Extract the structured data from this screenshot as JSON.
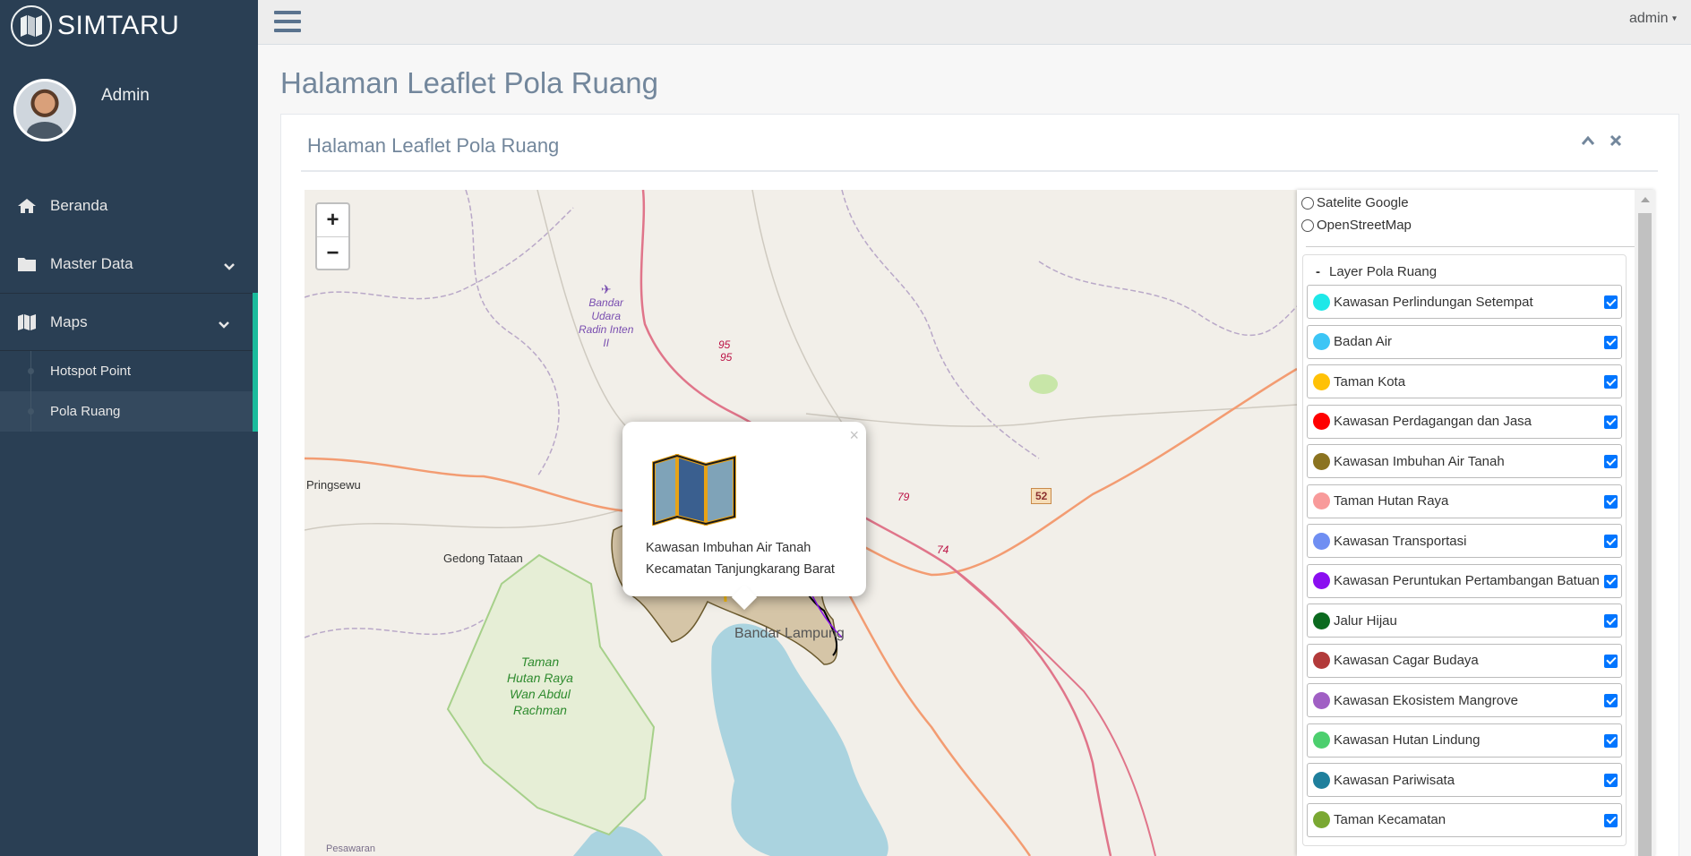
{
  "app": {
    "title": "SIMTARU",
    "icon": "map-icon"
  },
  "profile": {
    "name": "Admin"
  },
  "sidebar": {
    "items": [
      {
        "label": "Beranda",
        "icon": "home-icon"
      },
      {
        "label": "Master Data",
        "icon": "folder-icon"
      },
      {
        "label": "Maps",
        "icon": "map-icon"
      }
    ],
    "maps_submenu": [
      {
        "label": "Hotspot Point"
      },
      {
        "label": "Pola Ruang"
      }
    ]
  },
  "topnav": {
    "user": "admin"
  },
  "page": {
    "title": "Halaman Leaflet Pola Ruang"
  },
  "panel": {
    "title": "Halaman Leaflet Pola Ruang"
  },
  "map": {
    "zoom_in": "+",
    "zoom_out": "−",
    "labels": {
      "pringsewu": "Pringsewu",
      "gedong_tataan": "Gedong Tataan",
      "park_1": "Taman",
      "park_2": "Hutan Raya",
      "park_3": "Wan Abdul",
      "park_4": "Rachman",
      "airport_1": "Bandar",
      "airport_2": "Udara",
      "airport_3": "Radin Inten",
      "airport_4": "II",
      "bandar_lampung": "Bandar Lampung",
      "pesawaran": "Pesawaran",
      "road_95a": "95",
      "road_95b": "95",
      "road_79": "79",
      "road_74": "74",
      "shield_52": "52"
    },
    "popup": {
      "close": "×",
      "line1": "Kawasan Imbuhan Air Tanah",
      "line2": "Kecamatan Tanjungkarang Barat"
    }
  },
  "layer_control": {
    "basemaps": [
      "Satelite Google",
      "OpenStreetMap"
    ],
    "group_toggle": "-",
    "group_title": "Layer Pola Ruang",
    "layers": [
      {
        "label": "Kawasan Perlindungan Setempat",
        "color": "#1ee8e8",
        "checked": true
      },
      {
        "label": "Badan Air",
        "color": "#3cc5f5",
        "checked": true
      },
      {
        "label": "Taman Kota",
        "color": "#ffc107",
        "checked": true
      },
      {
        "label": "Kawasan Perdagangan dan Jasa",
        "color": "#ff0000",
        "checked": true
      },
      {
        "label": "Kawasan Imbuhan Air Tanah",
        "color": "#8b7320",
        "checked": true
      },
      {
        "label": "Taman Hutan Raya",
        "color": "#f89a9a",
        "checked": true
      },
      {
        "label": "Kawasan Transportasi",
        "color": "#6f8ef2",
        "checked": true
      },
      {
        "label": "Kawasan Peruntukan Pertambangan Batuan",
        "color": "#8a0ef0",
        "checked": true
      },
      {
        "label": "Jalur Hijau",
        "color": "#0b6a1f",
        "checked": true
      },
      {
        "label": "Kawasan Cagar Budaya",
        "color": "#b23a3a",
        "checked": true
      },
      {
        "label": "Kawasan Ekosistem Mangrove",
        "color": "#a05fc4",
        "checked": true
      },
      {
        "label": "Kawasan Hutan Lindung",
        "color": "#4ccf6e",
        "checked": true
      },
      {
        "label": "Kawasan Pariwisata",
        "color": "#1f7f9c",
        "checked": true
      },
      {
        "label": "Taman Kecamatan",
        "color": "#7aa832",
        "checked": true
      }
    ]
  }
}
